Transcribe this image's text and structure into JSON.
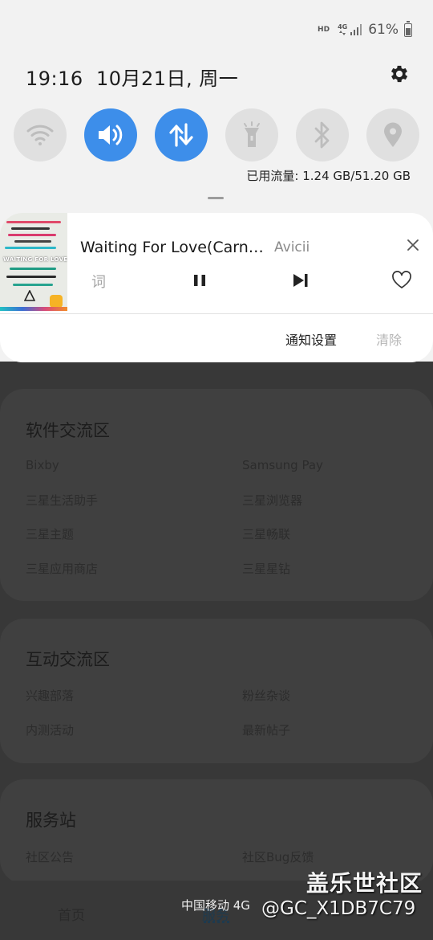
{
  "status_bar": {
    "hd": "HD",
    "network": "4G",
    "battery_percent": "61%"
  },
  "header": {
    "time": "19:16",
    "date": "10月21日, 周一"
  },
  "quick_settings": [
    {
      "name": "wifi",
      "icon": "wifi-icon",
      "active": false
    },
    {
      "name": "sound",
      "icon": "volume-icon",
      "active": true
    },
    {
      "name": "mobile-data",
      "icon": "data-arrows-icon",
      "active": true
    },
    {
      "name": "flashlight",
      "icon": "flashlight-icon",
      "active": false
    },
    {
      "name": "bluetooth",
      "icon": "bluetooth-icon",
      "active": false
    },
    {
      "name": "location",
      "icon": "location-icon",
      "active": false
    }
  ],
  "data_usage": "已用流量: 1.24 GB/51.20 GB",
  "media": {
    "title": "Waiting For Love(Carnage Remix)",
    "artist": "Avicii",
    "lyrics_label": "词",
    "album_caption": "WAITING FOR LOVE",
    "notification_settings": "通知设置",
    "clear": "清除"
  },
  "background_app": {
    "sections": [
      {
        "title": "软件交流区",
        "items": [
          "Bixby",
          "Samsung Pay",
          "三星生活助手",
          "三星浏览器",
          "三星主题",
          "三星畅联",
          "三星应用商店",
          "三星星钻"
        ]
      },
      {
        "title": "互动交流区",
        "items": [
          "兴趣部落",
          "粉丝杂谈",
          "内测活动",
          "最新帖子"
        ]
      },
      {
        "title": "服务站",
        "items": [
          "社区公告",
          "社区Bug反馈"
        ]
      }
    ],
    "nav": [
      "首页",
      "服务"
    ]
  },
  "carrier": "中国移动 4G",
  "watermark": {
    "title": "盖乐世社区",
    "handle": "@GC_X1DB7C79"
  },
  "colors": {
    "shade_bg": "#f2f2f2",
    "tile_active": "#3d8eea",
    "tile_inactive": "#e0e0e0",
    "dim_bg": "#383838"
  }
}
